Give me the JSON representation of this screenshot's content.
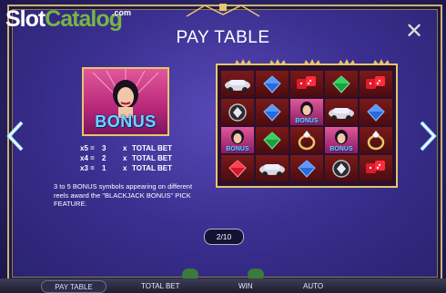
{
  "brand": {
    "logo_part1": "Slot",
    "logo_part2": "Catalog",
    "logo_suffix": ".com"
  },
  "title": "PAY TABLE",
  "close_symbol": "✕",
  "bonus_symbol": {
    "word": "BONUS"
  },
  "payouts": [
    {
      "mult": "x5 =",
      "value": "3",
      "x": "x",
      "label": "TOTAL BET"
    },
    {
      "mult": "x4 =",
      "value": "2",
      "x": "x",
      "label": "TOTAL BET"
    },
    {
      "mult": "x3 =",
      "value": "1",
      "x": "x",
      "label": "TOTAL BET"
    }
  ],
  "description": "3 to 5 BONUS symbols appearing on different reels award the \"BLACKJACK BONUS\" PICK FEATURE.",
  "reel_grid": [
    [
      "car-icon",
      "sapphire-icon",
      "dice-icon",
      "emerald-icon",
      "dice-icon"
    ],
    [
      "diamond-chip-icon",
      "sapphire-icon",
      "bonus",
      "car-icon",
      "sapphire-icon"
    ],
    [
      "bonus",
      "emerald-icon",
      "ring-icon",
      "bonus",
      "ring-icon"
    ],
    [
      "ruby-icon",
      "car-icon",
      "sapphire-icon",
      "diamond-chip-icon",
      "dice-icon"
    ]
  ],
  "grid_bonus_word": "BONUS",
  "pager": "2/10",
  "bottom_bar": {
    "pay_table": "PAY TABLE",
    "total_bet": "TOTAL BET",
    "win": "WIN",
    "auto": "AUTO"
  },
  "colors": {
    "panel": "#3a2f8f",
    "gold": "#e7c56a",
    "bonus_text": "#6fd3ff",
    "logo_green": "#78b544"
  }
}
